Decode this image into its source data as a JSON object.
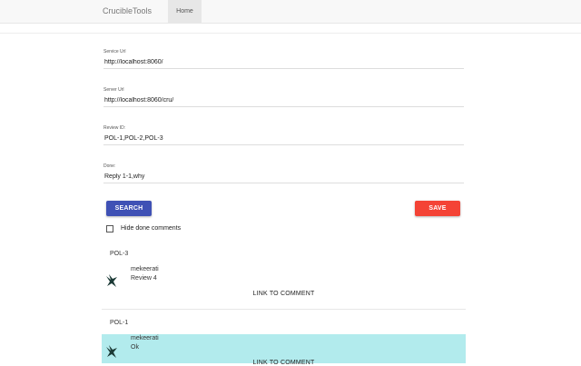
{
  "navbar": {
    "brand": "CrucibleTools",
    "tab_home": "Home"
  },
  "form": {
    "service_url_label": "Service Url",
    "service_url_value": "http://localhost:8060/",
    "server_url_label": "Server Url",
    "server_url_value": "http://localhost:8060/cru/",
    "review_id_label": "Review ID:",
    "review_id_value": "POL-1,POL-2,POL-3",
    "done_label": "Done:",
    "done_value": "Reply 1-1,why"
  },
  "actions": {
    "search_label": "SEARCH",
    "save_label": "SAVE"
  },
  "options": {
    "hide_done_label": "Hide done comments",
    "hide_done_checked": false
  },
  "reviews": [
    {
      "id": "POL-3",
      "comment": {
        "author": "mekeerati",
        "text": "Review 4",
        "link": "LINK TO COMMENT",
        "highlight": "#ffffff"
      }
    },
    {
      "id": "POL-1",
      "comment": {
        "author": "mekeerati",
        "text": "Ok",
        "link": "LINK TO COMMENT",
        "highlight": "#b2ebed"
      }
    }
  ],
  "colors": {
    "primary": "#3f51b5",
    "danger": "#f44336",
    "highlight": "#b2ebed"
  },
  "icons": {
    "avatar": "bird-avatar-icon"
  }
}
